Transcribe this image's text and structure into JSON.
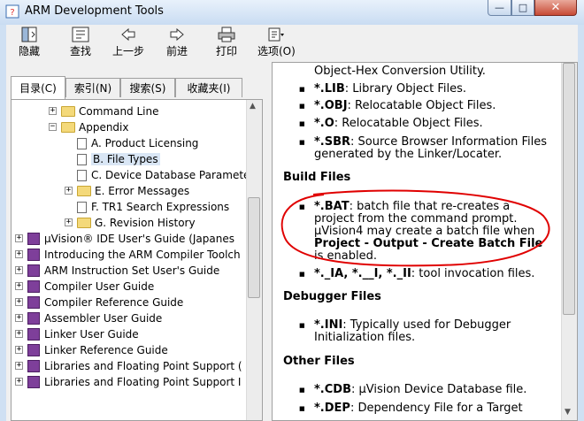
{
  "window": {
    "title": "ARM Development Tools",
    "minimize": "—",
    "maximize": "□",
    "close": "✕"
  },
  "toolbar": [
    {
      "label": "隐藏",
      "icon": "hide-icon"
    },
    {
      "label": "查找",
      "icon": "find-icon"
    },
    {
      "label": "上一步",
      "icon": "back-arrow-icon"
    },
    {
      "label": "前进",
      "icon": "forward-arrow-icon"
    },
    {
      "label": "打印",
      "icon": "printer-icon"
    },
    {
      "label": "选项(O)",
      "icon": "options-icon"
    }
  ],
  "tabs": [
    "目录(C)",
    "索引(N)",
    "搜索(S)",
    "收藏夹(I)"
  ],
  "tree": [
    {
      "label": "Command Line",
      "icon": "folder",
      "indent": 2,
      "expander": "+"
    },
    {
      "label": "Appendix",
      "icon": "folder",
      "indent": 2,
      "expander": "−"
    },
    {
      "label": "A. Product Licensing",
      "icon": "page",
      "indent": 3
    },
    {
      "label": "B. File Types",
      "icon": "page",
      "indent": 3,
      "selected": true
    },
    {
      "label": "C. Device Database Paramete",
      "icon": "page",
      "indent": 3
    },
    {
      "label": "E. Error Messages",
      "icon": "folder",
      "indent": 3,
      "expander": "+"
    },
    {
      "label": "F. TR1 Search Expressions",
      "icon": "page",
      "indent": 3
    },
    {
      "label": "G. Revision History",
      "icon": "folder",
      "indent": 3,
      "expander": "+"
    },
    {
      "label": "µVision® IDE User's Guide (Japanes",
      "icon": "book",
      "indent": 0,
      "expander": "+"
    },
    {
      "label": "Introducing the ARM Compiler Toolch",
      "icon": "book",
      "indent": 0,
      "expander": "+"
    },
    {
      "label": "ARM Instruction Set User's Guide",
      "icon": "book",
      "indent": 0,
      "expander": "+"
    },
    {
      "label": "Compiler User Guide",
      "icon": "book",
      "indent": 0,
      "expander": "+"
    },
    {
      "label": "Compiler Reference Guide",
      "icon": "book",
      "indent": 0,
      "expander": "+"
    },
    {
      "label": "Assembler User Guide",
      "icon": "book",
      "indent": 0,
      "expander": "+"
    },
    {
      "label": "Linker User Guide",
      "icon": "book",
      "indent": 0,
      "expander": "+"
    },
    {
      "label": "Linker Reference Guide",
      "icon": "book",
      "indent": 0,
      "expander": "+"
    },
    {
      "label": "Libraries and Floating Point Support (",
      "icon": "book",
      "indent": 0,
      "expander": "+"
    },
    {
      "label": "Libraries and Floating Point Support I",
      "icon": "book",
      "indent": 0,
      "expander": "+"
    }
  ],
  "doc": {
    "top_continuation": "Object-Hex Conversion Utility.",
    "items_1": [
      {
        "key": "*.LIB",
        "text": ": Library Object Files."
      },
      {
        "key": "*.OBJ",
        "text": ": Relocatable Object Files."
      },
      {
        "key": "*.O",
        "text": ": Relocatable Object Files."
      },
      {
        "key": "*.SBR",
        "text": ": Source Browser Information Files generated by the Linker/Locater."
      }
    ],
    "heading_build": "Build Files",
    "bat_key": "*.BAT",
    "bat_text": ": batch file that re-creates a project from the command prompt. µVision4 may create a batch file when ",
    "bat_menu": "Project - Output - Create Batch File",
    "bat_tail": " is enabled.",
    "ia_key": "*._IA, *.__I, *._II",
    "ia_text": ": tool invocation files.",
    "heading_debugger": "Debugger Files",
    "ini_key": "*.INI",
    "ini_text": ": Typically used for Debugger Initialization files.",
    "heading_other": "Other Files",
    "cdb_key": "*.CDB",
    "cdb_text": ": µVision Device Database file.",
    "dep_key": "*.DEP",
    "dep_text": ": Dependency File for a Target"
  },
  "colors": {
    "annotation": "#e00000",
    "selection": "#d9e6f5",
    "folder": "#f4d97a",
    "book": "#7e3f9a"
  }
}
